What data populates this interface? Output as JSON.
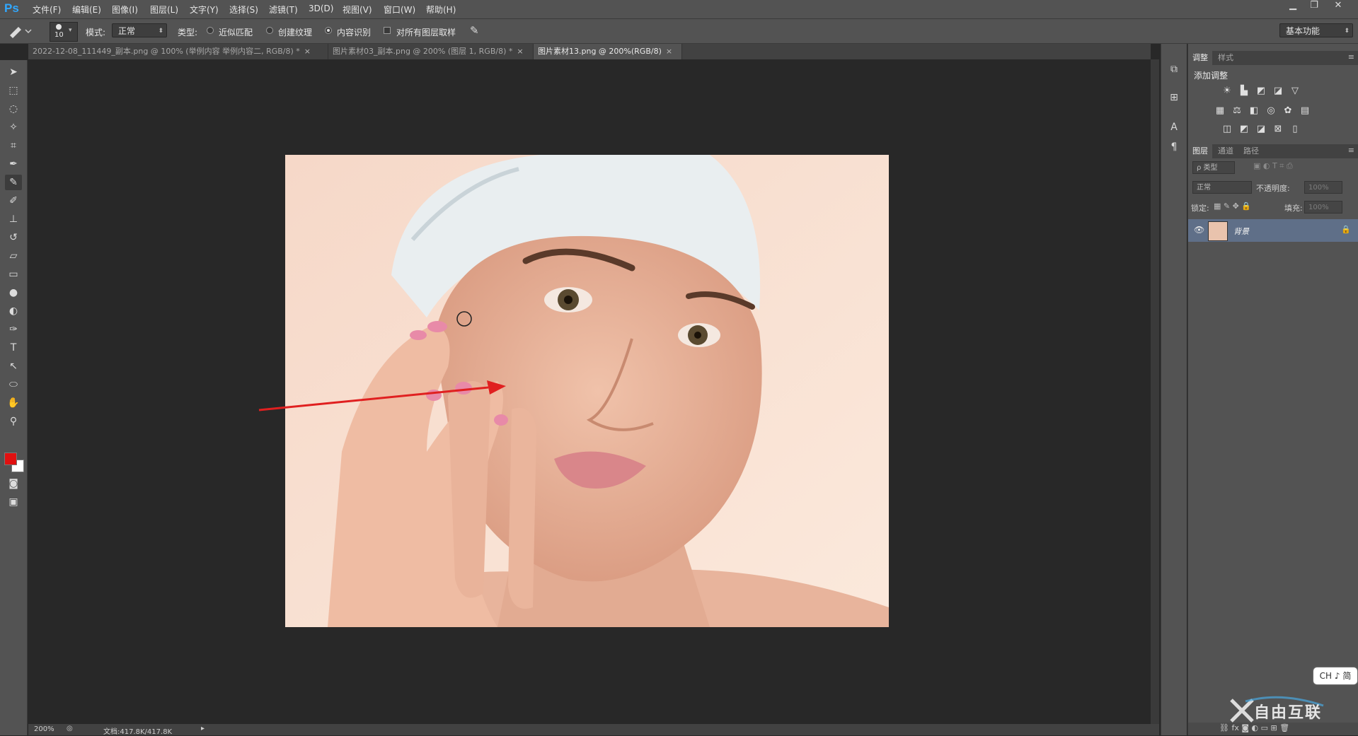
{
  "app": {
    "logo": "Ps"
  },
  "menu": [
    "文件(F)",
    "编辑(E)",
    "图像(I)",
    "图层(L)",
    "文字(Y)",
    "选择(S)",
    "滤镜(T)",
    "3D(D)",
    "视图(V)",
    "窗口(W)",
    "帮助(H)"
  ],
  "window_controls": {
    "minimize": "▁",
    "restore": "❐",
    "close": "✕"
  },
  "options": {
    "brush_size": "10",
    "mode_label": "模式:",
    "mode_value": "正常",
    "type_label": "类型:",
    "radio_near": "近似匹配",
    "radio_texture": "创建纹理",
    "radio_content": "内容识别",
    "checkbox_all_layers": "对所有图层取样",
    "workspace": "基本功能"
  },
  "tabs": [
    {
      "label": "2022-12-08_111449_副本.png @ 100% (举例内容 举例内容二, RGB/8) *",
      "active": false
    },
    {
      "label": "图片素材03_副本.png @ 200% (图层 1, RGB/8) *",
      "active": false
    },
    {
      "label": "图片素材13.png @ 200%(RGB/8)",
      "active": true
    }
  ],
  "status": {
    "zoom": "200%",
    "doc_info": "文档:417.8K/417.8K"
  },
  "right_panel": {
    "adjust_tab": "调整",
    "style_tab": "样式",
    "add_adjustment": "添加调整",
    "layers_tab": "图层",
    "channels_tab": "通道",
    "paths_tab": "路径",
    "kind_filter": "ρ 类型",
    "blend_mode": "正常",
    "opacity_label": "不透明度:",
    "opacity_value": "100%",
    "lock_label": "锁定:",
    "fill_label": "填充:",
    "fill_value": "100%",
    "layer_name": "背景"
  },
  "ime": {
    "text": "CH ♪ 简"
  },
  "watermark": {
    "text": "自由互联"
  },
  "colors": {
    "foreground": "#e01010",
    "background": "#ffffff",
    "accent": "#31a8ff",
    "selected_layer": "#5f6f88"
  }
}
